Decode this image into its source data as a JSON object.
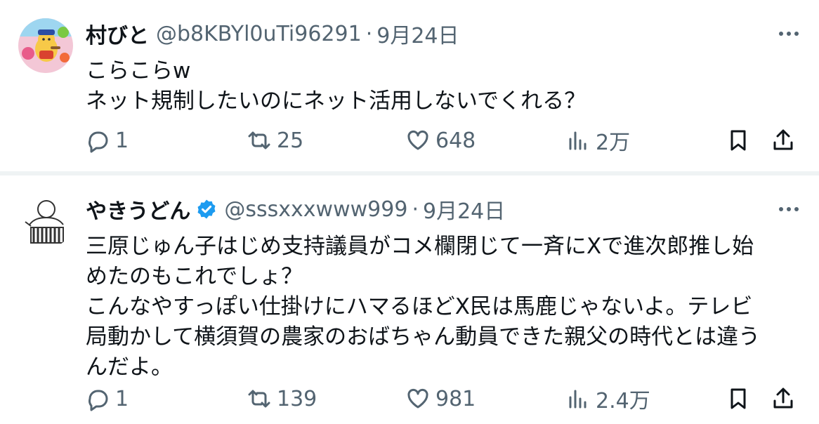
{
  "tweets": [
    {
      "name": "村びと",
      "handle": "@b8KBYl0uTi96291",
      "separator": "·",
      "date": "9月24日",
      "verified": false,
      "lines": [
        "こらこらw",
        "ネット規制したいのにネット活用しないでくれる？"
      ],
      "replies": "1",
      "retweets": "25",
      "likes": "648",
      "views": "2万"
    },
    {
      "name": "やきうどん",
      "handle": "@sssxxxwww999",
      "separator": "·",
      "date": "9月24日",
      "verified": true,
      "lines": [
        "三原じゅん子はじめ支持議員がコメ欄閉じて一斉にXで進次郎推し始",
        "めたのもこれでしょ？",
        "こんなやすっぽい仕掛けにハマるほどX民は馬鹿じゃないよ。テレビ",
        "局動かして横須賀の農家のおばちゃん動員できた親父の時代とは違う",
        "んだよ。"
      ],
      "replies": "1",
      "retweets": "139",
      "likes": "981",
      "views": "2.4万"
    }
  ],
  "colors": {
    "text": "#0f1419",
    "secondary": "#536471",
    "verified": "#1d9bf0",
    "divider": "#eff3f4"
  },
  "icons": {
    "reply": "reply-icon",
    "retweet": "retweet-icon",
    "like": "heart-icon",
    "views": "views-icon",
    "bookmark": "bookmark-icon",
    "share": "share-icon",
    "more": "more-icon",
    "verified": "verified-badge-icon"
  }
}
